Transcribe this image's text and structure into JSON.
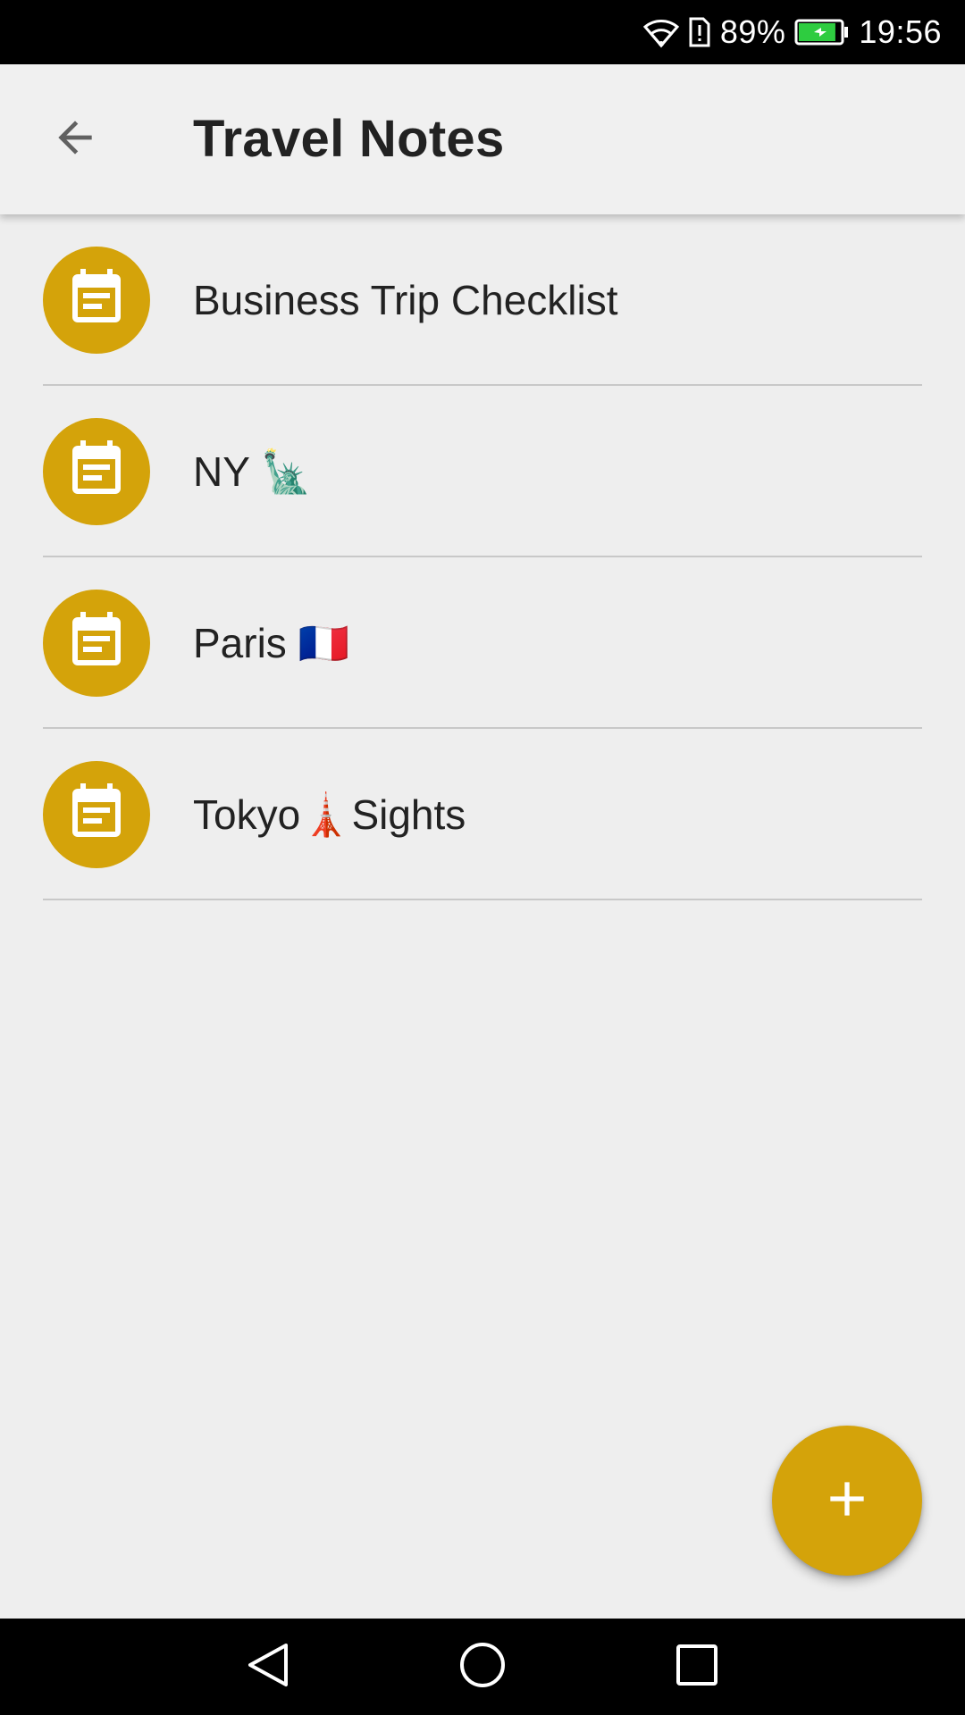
{
  "status_bar": {
    "wifi_icon": "wifi-icon",
    "alert_icon": "sim-alert-icon",
    "battery_percent": "89%",
    "battery_icon": "battery-charging-icon",
    "battery_level": 0.89,
    "time": "19:56"
  },
  "app_bar": {
    "back_icon": "arrow-back-icon",
    "title": "Travel Notes"
  },
  "notes": [
    {
      "title": "Business Trip Checklist",
      "icon": "note-calendar-icon"
    },
    {
      "title": "NY 🗽",
      "icon": "note-calendar-icon"
    },
    {
      "title": "Paris 🇫🇷",
      "icon": "note-calendar-icon"
    },
    {
      "title": "Tokyo🗼Sights",
      "icon": "note-calendar-icon"
    }
  ],
  "fab": {
    "icon": "plus-icon"
  },
  "nav_bar": {
    "back_icon": "nav-back-icon",
    "home_icon": "nav-home-icon",
    "recents_icon": "nav-recents-icon"
  },
  "colors": {
    "accent": "#d4a30a",
    "background": "#eeeeee",
    "app_bar": "#f0f0f0",
    "text_primary": "#222222",
    "divider": "#c8c8c8",
    "battery_fill": "#2ecc40"
  }
}
